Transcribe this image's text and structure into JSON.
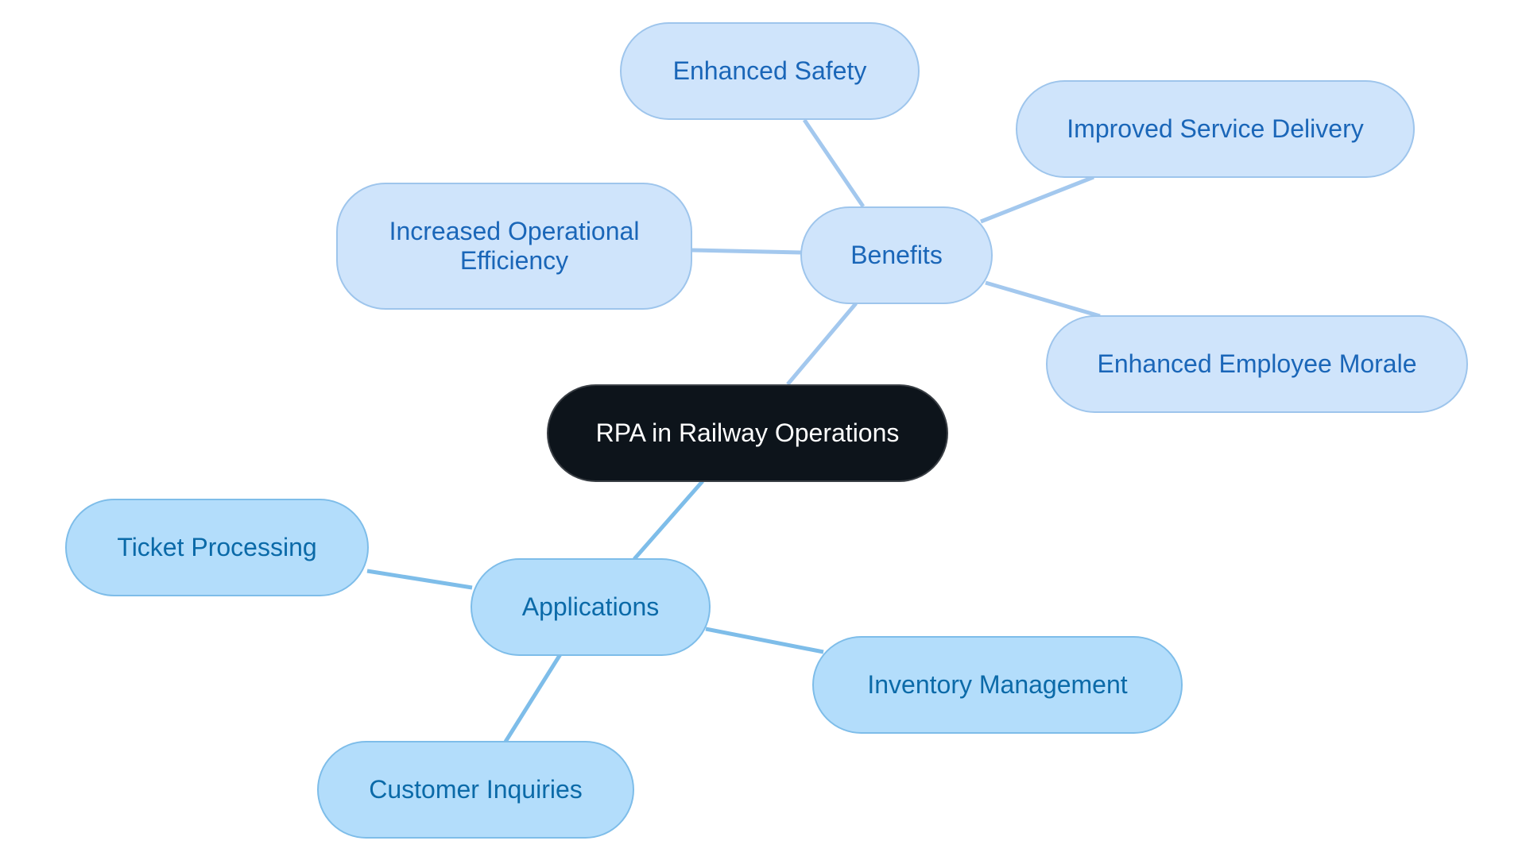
{
  "diagram": {
    "type": "mind-map",
    "root": {
      "id": "root",
      "label": "RPA in Railway Operations"
    },
    "branches": [
      {
        "id": "benefits",
        "label": "Benefits",
        "children": [
          {
            "id": "enhanced-safety",
            "label": "Enhanced Safety"
          },
          {
            "id": "improved-service-delivery",
            "label": "Improved Service Delivery"
          },
          {
            "id": "increased-operational-efficiency",
            "label": "Increased Operational Efficiency"
          },
          {
            "id": "enhanced-employee-morale",
            "label": "Enhanced Employee Morale"
          }
        ]
      },
      {
        "id": "applications",
        "label": "Applications",
        "children": [
          {
            "id": "ticket-processing",
            "label": "Ticket Processing"
          },
          {
            "id": "inventory-management",
            "label": "Inventory Management"
          },
          {
            "id": "customer-inquiries",
            "label": "Customer Inquiries"
          }
        ]
      }
    ],
    "colors": {
      "root_fill": "#0d141b",
      "root_text": "#ffffff",
      "benefits_fill": "#cfe4fb",
      "benefits_text": "#1a66b8",
      "benefits_edge": "#a3c8ee",
      "applications_fill": "#b3ddfb",
      "applications_text": "#0b6aa8",
      "applications_edge": "#7ebde9"
    }
  }
}
